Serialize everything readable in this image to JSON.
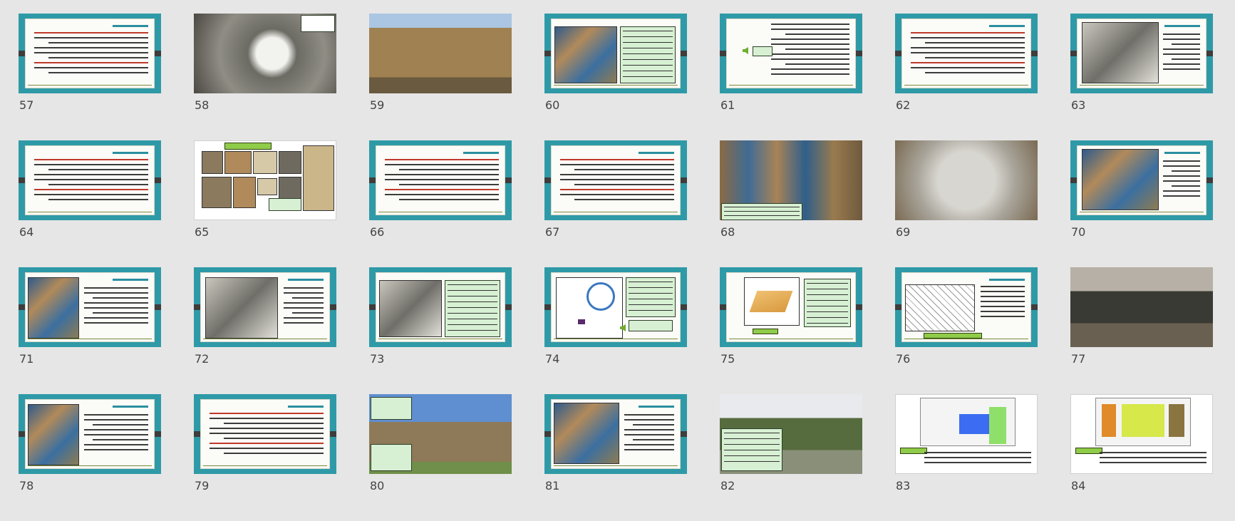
{
  "slides": [
    {
      "num": "57",
      "kind": "text"
    },
    {
      "num": "58",
      "kind": "photo-ruin"
    },
    {
      "num": "59",
      "kind": "photo-building"
    },
    {
      "num": "60",
      "kind": "tiles-caption"
    },
    {
      "num": "61",
      "kind": "bullets-arrow"
    },
    {
      "num": "62",
      "kind": "text"
    },
    {
      "num": "63",
      "kind": "image-right-text"
    },
    {
      "num": "64",
      "kind": "text"
    },
    {
      "num": "65",
      "kind": "white-collage"
    },
    {
      "num": "66",
      "kind": "text"
    },
    {
      "num": "67",
      "kind": "text"
    },
    {
      "num": "68",
      "kind": "photo-facade"
    },
    {
      "num": "69",
      "kind": "photo-stone"
    },
    {
      "num": "70",
      "kind": "image-right-text"
    },
    {
      "num": "71",
      "kind": "tower-text"
    },
    {
      "num": "72",
      "kind": "stairs-text"
    },
    {
      "num": "73",
      "kind": "image-caption"
    },
    {
      "num": "74",
      "kind": "diagram-arrow"
    },
    {
      "num": "75",
      "kind": "diagram-caption"
    },
    {
      "num": "76",
      "kind": "diagram-text"
    },
    {
      "num": "77",
      "kind": "photo-pavilion"
    },
    {
      "num": "78",
      "kind": "tower-text"
    },
    {
      "num": "79",
      "kind": "text"
    },
    {
      "num": "80",
      "kind": "photo-tower"
    },
    {
      "num": "81",
      "kind": "image-text"
    },
    {
      "num": "82",
      "kind": "photo-garden"
    },
    {
      "num": "83",
      "kind": "plan-blue"
    },
    {
      "num": "84",
      "kind": "plan-yellow"
    }
  ],
  "colors": {
    "background": "#e6e6e6",
    "slide_frame": "#2f9aa7",
    "caption_fill": "#d7f0d3",
    "label_green": "#8fcc4a"
  }
}
